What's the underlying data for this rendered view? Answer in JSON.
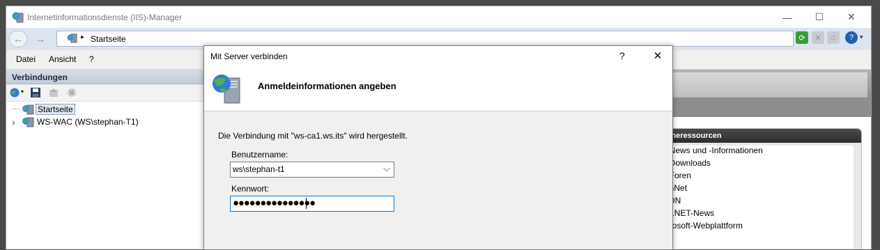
{
  "window": {
    "title": "Internetinformationsdienste (IIS)-Manager",
    "minimize_glyph": "—",
    "maximize_glyph": "☐",
    "close_glyph": "✕"
  },
  "address": {
    "back_glyph": "←",
    "forward_glyph": "→",
    "separator_glyph": "▸",
    "path": "Startseite",
    "icons": [
      "refresh-icon",
      "stop-icon",
      "home-icon",
      "help-icon"
    ]
  },
  "menu": {
    "items": [
      "Datei",
      "Ansicht",
      "?"
    ]
  },
  "connections": {
    "header": "Verbindungen",
    "tree": [
      {
        "label": "Startseite",
        "selected": true
      },
      {
        "label": "WS-WAC (WS\\stephan-T1)",
        "selected": false
      }
    ],
    "expand_glyph": "›"
  },
  "online": {
    "header": "Onlineressourcen",
    "links": [
      "IIS-News und -Informationen",
      "IIS-Downloads",
      "IIS-Foren",
      "TechNet",
      "MSDN",
      "ASP.NET-News",
      "Microsoft-Webplattform"
    ]
  },
  "dialog": {
    "title": "Mit Server verbinden",
    "help_glyph": "?",
    "close_glyph": "✕",
    "heading": "Anmeldeinformationen angeben",
    "message": "Die Verbindung mit \"ws-ca1.ws.its\" wird hergestellt.",
    "username_label": "Benutzername:",
    "username_value": "ws\\stephan-t1",
    "password_label": "Kennwort:",
    "password_value": "●●●●●●●●●●●●●●●",
    "dropdown_glyph": "⌵"
  },
  "colors": {
    "selection": "#dde8f5",
    "focus_border": "#0078d7",
    "online_header": "#2c2c2c"
  }
}
